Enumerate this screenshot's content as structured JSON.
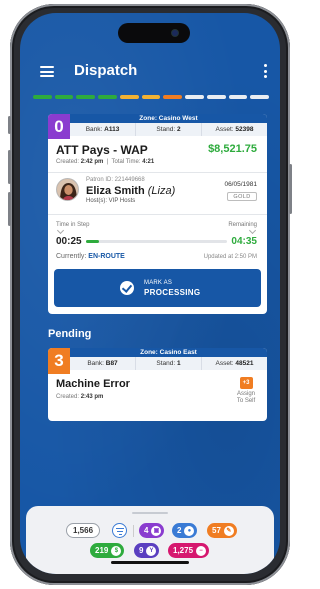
{
  "app": {
    "title": "Dispatch"
  },
  "progress_colors": [
    "#2eab3d",
    "#2eab3d",
    "#2eab3d",
    "#2eab3d",
    "#f2b233",
    "#f2b233",
    "#f07d22",
    "#e9edf2",
    "#e9edf2",
    "#e9edf2",
    "#e9edf2"
  ],
  "active_call": {
    "number": "0",
    "number_color": "#8a3ccf",
    "zone": "Zone: Casino West",
    "bank_label": "Bank:",
    "bank": "A113",
    "stand_label": "Stand:",
    "stand": "2",
    "asset_label": "Asset:",
    "asset": "52398",
    "title": "ATT Pays - WAP",
    "amount": "$8,521.75",
    "created_label": "Created:",
    "created": "2:42 pm",
    "total_label": "Total Time:",
    "total": "4:21",
    "patron_id": "Patron ID: 221449668",
    "patron_name": "Eliza Smith",
    "patron_nick": "(Liza)",
    "host": "Host(s): VIP Hosts",
    "dob": "06/05/1981",
    "tier": "GOLD",
    "time_in_step_label": "Time in Step",
    "remaining_label": "Remaining",
    "time_in_step": "00:25",
    "remaining": "04:35",
    "progress": 0.09,
    "status_label": "Currently:",
    "status": "EN-ROUTE",
    "updated": "Updated at 2:50 PM",
    "action_top": "MARK AS",
    "action_main": "PROCESSING"
  },
  "pending_label": "Pending",
  "pending_call": {
    "number": "3",
    "number_color": "#f07d22",
    "zone": "Zone: Casino East",
    "bank_label": "Bank:",
    "bank": "B87",
    "stand_label": "Stand:",
    "stand": "1",
    "asset_label": "Asset:",
    "asset": "48521",
    "title": "Machine Error",
    "created_label": "Created:",
    "created": "2:43 pm",
    "assign_icon": "+3",
    "assign_line1": "Assign",
    "assign_line2": "To Self"
  },
  "bottom_bar": {
    "count": "1,566",
    "purple_count": "4",
    "blue_count": "2",
    "orange_count": "57",
    "green_count": "219",
    "violet_count": "9",
    "pink_count": "1,275",
    "colors": {
      "purple": "#8a3ccf",
      "blue": "#3a7bd5",
      "orange": "#f07d22",
      "green": "#2eab3d",
      "violet": "#5a3fc0",
      "pink": "#d6186f"
    }
  }
}
